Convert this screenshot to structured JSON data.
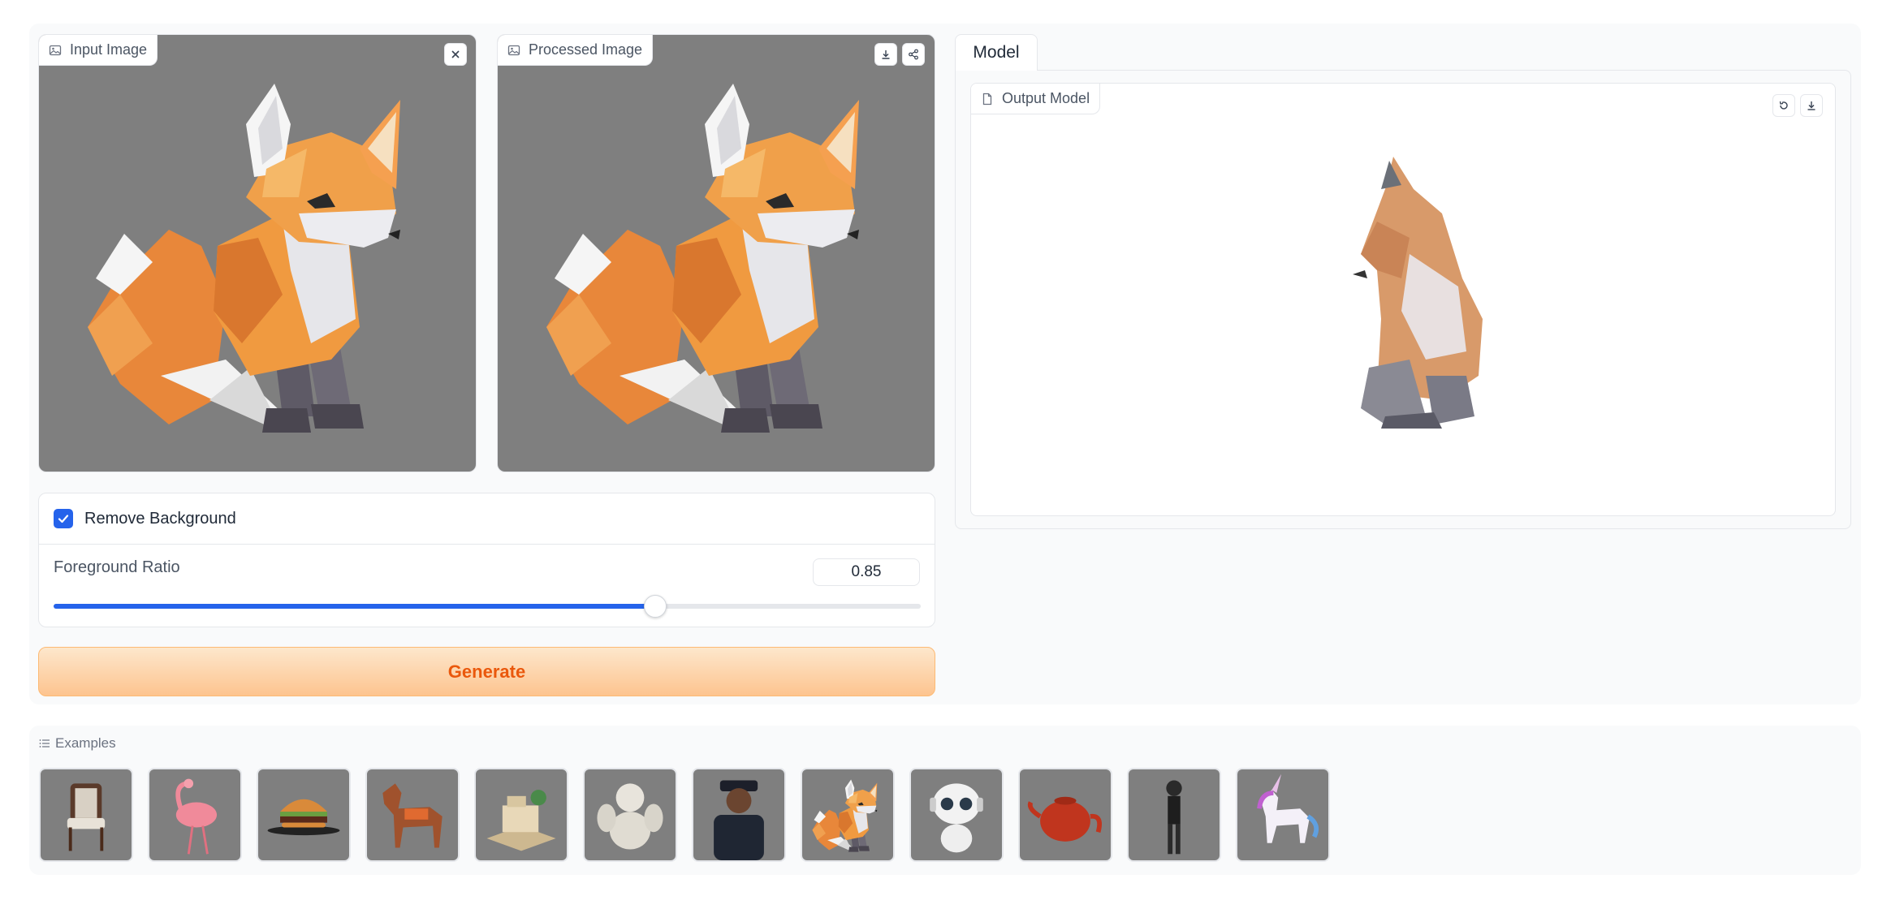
{
  "input_image": {
    "label": "Input Image",
    "icon": "image-icon"
  },
  "processed_image": {
    "label": "Processed Image",
    "icon": "image-icon"
  },
  "remove_background": {
    "label": "Remove Background",
    "checked": true
  },
  "foreground_ratio": {
    "label": "Foreground Ratio",
    "value": "0.85",
    "fraction": 0.694
  },
  "generate": {
    "label": "Generate"
  },
  "model_tab": {
    "label": "Model"
  },
  "output_model": {
    "label": "Output Model",
    "icon": "file-icon"
  },
  "examples": {
    "label": "Examples",
    "items": [
      {
        "name": "chair"
      },
      {
        "name": "flamingo"
      },
      {
        "name": "hamburger"
      },
      {
        "name": "horse"
      },
      {
        "name": "house-diorama"
      },
      {
        "name": "cherub-statue"
      },
      {
        "name": "police-officer"
      },
      {
        "name": "fox"
      },
      {
        "name": "robot"
      },
      {
        "name": "teapot"
      },
      {
        "name": "catwoman-figure"
      },
      {
        "name": "unicorn"
      }
    ]
  },
  "colors": {
    "accent": "#2563eb",
    "generate_text": "#ea580c",
    "image_bg": "#7f7f7f"
  }
}
